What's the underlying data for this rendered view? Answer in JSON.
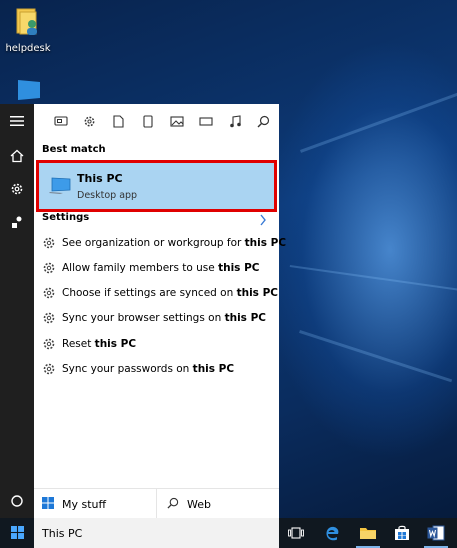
{
  "desktop": {
    "icon_label": "helpdesk"
  },
  "rail": {
    "items": [
      "hamburger-icon",
      "home-icon",
      "gear-icon",
      "feedback-icon",
      "power-icon"
    ]
  },
  "filters": [
    "apps-icon",
    "settings-icon",
    "documents-icon",
    "folders-icon",
    "photos-icon",
    "videos-icon",
    "music-icon",
    "web-search-icon"
  ],
  "best_match": {
    "heading": "Best match",
    "title": "This PC",
    "subtitle": "Desktop app",
    "highlight_color": "#e00000"
  },
  "settings": {
    "heading": "Settings",
    "items": [
      {
        "prefix": "See organization or workgroup for ",
        "bold": "this PC"
      },
      {
        "prefix": "Allow family members to use ",
        "bold": "this PC"
      },
      {
        "prefix": "Choose if settings are synced on ",
        "bold": "this PC"
      },
      {
        "prefix": "Sync your browser settings on ",
        "bold": "this PC"
      },
      {
        "prefix": "Reset ",
        "bold": "this PC"
      },
      {
        "prefix": "Sync your passwords on ",
        "bold": "this PC"
      }
    ]
  },
  "bottom": {
    "my_stuff": "My stuff",
    "web": "Web"
  },
  "taskbar": {
    "search_value": "This PC",
    "icons": [
      "task-view-icon",
      "edge-icon",
      "file-explorer-icon",
      "store-icon",
      "word-icon"
    ]
  }
}
